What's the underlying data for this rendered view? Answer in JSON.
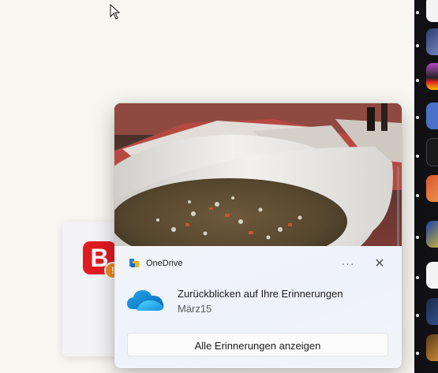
{
  "notification": {
    "app_name": "OneDrive",
    "more_icon": "more-dots-icon",
    "more_glyph": "···",
    "close_icon": "close-icon",
    "close_glyph": "✕",
    "title": "Zurückblicken auf Ihre Erinnerungen",
    "subtitle": "März15",
    "action_label": "Alle Erinnerungen anzeigen"
  },
  "background_app": {
    "logo_letter": "B",
    "badge_glyph": "!",
    "logo_color": "#e11b22",
    "badge_color": "#f08a1c"
  },
  "colors": {
    "desktop": "#f8f6f0",
    "dock": "#111114",
    "onedrive_blue": "#0f6cbd"
  }
}
